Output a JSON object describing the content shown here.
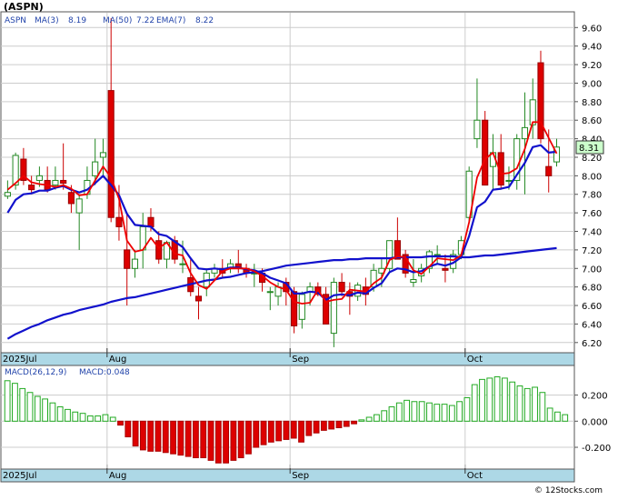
{
  "ticker_label": "(ASPN)",
  "legend": {
    "symbol": "ASPN",
    "ma3_label": "MA(3)",
    "ma3_value": "8.19",
    "ma50_label": "MA(50)",
    "ma50_value": "7.22",
    "ema7_label": "EMA(7)",
    "ema7_value": "8.22"
  },
  "last_price_badge": "8.31",
  "macd_legend": {
    "params": "MACD(26,12,9)",
    "value_text": "MACD:0.048"
  },
  "watermark": "© 12Stocks.com",
  "colors": {
    "up_candle": "#33aa33",
    "down_candle": "#dd0000",
    "ma3": "#ee0000",
    "ma50": "#1111cc",
    "ema7": "#1111cc",
    "macd_up": "#22aa22",
    "macd_down": "#dd0000",
    "axis_band": "#add8e6",
    "badge_bg": "#ccffcc"
  },
  "chart_data": [
    {
      "type": "candlestick",
      "title": "ASPN",
      "yticks": [
        "9.60",
        "9.40",
        "9.20",
        "9.00",
        "8.80",
        "8.60",
        "8.40",
        "8.20",
        "8.00",
        "7.80",
        "7.60",
        "7.40",
        "7.20",
        "7.00",
        "6.80",
        "6.60",
        "6.40",
        "6.20"
      ],
      "x_labels": [
        "2025Jul",
        "Aug",
        "Sep",
        "Oct"
      ],
      "grid": true,
      "candles": [
        [
          7.78,
          7.95,
          7.75,
          7.82
        ],
        [
          7.9,
          8.25,
          7.85,
          8.22
        ],
        [
          8.18,
          8.3,
          7.9,
          7.95
        ],
        [
          7.9,
          8.0,
          7.8,
          7.85
        ],
        [
          7.95,
          8.1,
          7.88,
          8.0
        ],
        [
          7.95,
          8.1,
          7.82,
          7.85
        ],
        [
          7.9,
          8.1,
          7.85,
          7.95
        ],
        [
          7.95,
          8.35,
          7.85,
          7.92
        ],
        [
          7.82,
          7.9,
          7.6,
          7.7
        ],
        [
          7.6,
          7.8,
          7.2,
          7.75
        ],
        [
          7.8,
          8.1,
          7.75,
          7.95
        ],
        [
          8.0,
          8.4,
          7.9,
          8.15
        ],
        [
          8.2,
          8.4,
          8.0,
          8.25
        ],
        [
          8.92,
          9.7,
          7.5,
          7.55
        ],
        [
          7.55,
          7.9,
          7.3,
          7.45
        ],
        [
          7.2,
          7.6,
          6.6,
          7.0
        ],
        [
          7.0,
          7.2,
          6.9,
          7.1
        ],
        [
          7.2,
          7.6,
          7.0,
          7.45
        ],
        [
          7.55,
          7.65,
          7.4,
          7.45
        ],
        [
          7.3,
          7.4,
          7.05,
          7.1
        ],
        [
          7.1,
          7.3,
          7.0,
          7.28
        ],
        [
          7.3,
          7.35,
          7.05,
          7.1
        ],
        [
          7.05,
          7.3,
          6.95,
          7.05
        ],
        [
          6.9,
          7.1,
          6.7,
          6.75
        ],
        [
          6.7,
          6.8,
          6.45,
          6.65
        ],
        [
          6.8,
          7.0,
          6.7,
          6.95
        ],
        [
          6.95,
          7.05,
          6.9,
          7.0
        ],
        [
          7.0,
          7.1,
          6.9,
          6.95
        ],
        [
          7.0,
          7.1,
          6.95,
          7.05
        ],
        [
          7.05,
          7.2,
          6.95,
          7.0
        ],
        [
          7.0,
          7.05,
          6.9,
          6.95
        ],
        [
          6.95,
          7.05,
          6.8,
          6.95
        ],
        [
          6.95,
          7.0,
          6.75,
          6.85
        ],
        [
          6.75,
          6.8,
          6.55,
          6.75
        ],
        [
          6.7,
          6.85,
          6.6,
          6.8
        ],
        [
          6.85,
          6.9,
          6.6,
          6.75
        ],
        [
          6.75,
          6.8,
          6.3,
          6.38
        ],
        [
          6.45,
          6.75,
          6.35,
          6.72
        ],
        [
          6.75,
          6.85,
          6.6,
          6.8
        ],
        [
          6.8,
          6.85,
          6.7,
          6.72
        ],
        [
          6.72,
          6.8,
          6.4,
          6.4
        ],
        [
          6.3,
          6.9,
          6.15,
          6.85
        ],
        [
          6.85,
          6.95,
          6.7,
          6.75
        ],
        [
          6.75,
          6.85,
          6.5,
          6.7
        ],
        [
          6.7,
          6.85,
          6.65,
          6.82
        ],
        [
          6.8,
          6.9,
          6.6,
          6.72
        ],
        [
          6.8,
          7.05,
          6.75,
          6.98
        ],
        [
          6.95,
          7.1,
          6.8,
          7.0
        ],
        [
          7.0,
          7.3,
          6.95,
          7.3
        ],
        [
          7.3,
          7.55,
          7.1,
          7.1
        ],
        [
          7.15,
          7.2,
          6.9,
          6.95
        ],
        [
          6.85,
          7.1,
          6.8,
          6.88
        ],
        [
          6.92,
          7.05,
          6.85,
          7.0
        ],
        [
          7.0,
          7.2,
          6.95,
          7.18
        ],
        [
          7.15,
          7.25,
          7.05,
          7.15
        ],
        [
          7.0,
          7.15,
          6.85,
          6.98
        ],
        [
          7.0,
          7.2,
          6.95,
          7.15
        ],
        [
          7.15,
          7.35,
          7.1,
          7.3
        ],
        [
          7.55,
          8.1,
          7.5,
          8.05
        ],
        [
          8.4,
          9.05,
          8.3,
          8.6
        ],
        [
          8.6,
          8.7,
          7.9,
          7.9
        ],
        [
          8.1,
          8.45,
          7.85,
          8.25
        ],
        [
          8.25,
          8.45,
          7.85,
          7.9
        ],
        [
          7.95,
          8.1,
          7.85,
          7.95
        ],
        [
          7.95,
          8.45,
          7.85,
          8.4
        ],
        [
          8.4,
          8.9,
          7.8,
          8.52
        ],
        [
          8.55,
          9.05,
          8.4,
          8.82
        ],
        [
          9.22,
          9.35,
          8.35,
          8.4
        ],
        [
          8.1,
          8.5,
          7.82,
          8.0
        ],
        [
          8.15,
          8.4,
          8.1,
          8.31
        ]
      ],
      "ma3": [
        7.85,
        7.92,
        8.0,
        7.93,
        7.91,
        7.9,
        7.88,
        7.9,
        7.86,
        7.79,
        7.8,
        7.95,
        8.1,
        7.98,
        7.75,
        7.3,
        7.18,
        7.2,
        7.33,
        7.22,
        7.28,
        7.16,
        7.14,
        6.95,
        6.82,
        6.78,
        6.87,
        6.97,
        7.0,
        7.0,
        7.0,
        6.97,
        6.92,
        6.85,
        6.8,
        6.77,
        6.64,
        6.62,
        6.63,
        6.77,
        6.64,
        6.66,
        6.67,
        6.77,
        6.76,
        6.75,
        6.84,
        6.9,
        7.09,
        7.13,
        7.12,
        6.98,
        6.94,
        7.02,
        7.11,
        7.1,
        7.09,
        7.14,
        7.5,
        7.98,
        8.18,
        8.25,
        8.02,
        8.03,
        8.08,
        8.29,
        8.58,
        8.58,
        8.41,
        8.24
      ],
      "ema7": [
        7.6,
        7.74,
        7.8,
        7.81,
        7.84,
        7.84,
        7.87,
        7.89,
        7.85,
        7.82,
        7.85,
        7.92,
        8.0,
        7.9,
        7.79,
        7.59,
        7.47,
        7.46,
        7.45,
        7.37,
        7.35,
        7.29,
        7.23,
        7.11,
        7.0,
        6.99,
        7.0,
        6.99,
        7.01,
        7.01,
        6.99,
        6.98,
        6.95,
        6.9,
        6.87,
        6.84,
        6.73,
        6.73,
        6.75,
        6.74,
        6.66,
        6.71,
        6.72,
        6.71,
        6.74,
        6.73,
        6.79,
        6.84,
        6.96,
        7.0,
        6.99,
        6.96,
        6.97,
        7.02,
        7.05,
        7.03,
        7.06,
        7.12,
        7.35,
        7.66,
        7.72,
        7.85,
        7.86,
        7.88,
        8.01,
        8.14,
        8.31,
        8.33,
        8.25,
        8.26
      ],
      "ma50": [
        6.24,
        6.29,
        6.33,
        6.37,
        6.4,
        6.44,
        6.47,
        6.5,
        6.52,
        6.55,
        6.57,
        6.59,
        6.61,
        6.64,
        6.66,
        6.68,
        6.69,
        6.71,
        6.73,
        6.75,
        6.77,
        6.79,
        6.81,
        6.83,
        6.85,
        6.87,
        6.88,
        6.9,
        6.91,
        6.93,
        6.95,
        6.96,
        6.97,
        6.99,
        7.01,
        7.03,
        7.04,
        7.05,
        7.06,
        7.07,
        7.08,
        7.09,
        7.09,
        7.1,
        7.1,
        7.11,
        7.11,
        7.11,
        7.11,
        7.12,
        7.12,
        7.12,
        7.12,
        7.13,
        7.13,
        7.13,
        7.13,
        7.12,
        7.12,
        7.13,
        7.14,
        7.14,
        7.15,
        7.16,
        7.17,
        7.18,
        7.19,
        7.2,
        7.21,
        7.22
      ]
    },
    {
      "type": "bar",
      "title": "MACD(26,12,9)",
      "yticks": [
        "0.200",
        "0.000",
        "-0.200"
      ],
      "x_labels": [
        "2025Jul",
        "Aug",
        "Sep",
        "Oct"
      ],
      "values": [
        0.31,
        0.29,
        0.25,
        0.22,
        0.19,
        0.17,
        0.14,
        0.11,
        0.09,
        0.07,
        0.06,
        0.04,
        0.04,
        0.05,
        0.03,
        -0.03,
        -0.12,
        -0.19,
        -0.22,
        -0.23,
        -0.23,
        -0.24,
        -0.25,
        -0.26,
        -0.27,
        -0.28,
        -0.28,
        -0.3,
        -0.32,
        -0.32,
        -0.3,
        -0.28,
        -0.25,
        -0.2,
        -0.18,
        -0.16,
        -0.15,
        -0.14,
        -0.13,
        -0.16,
        -0.11,
        -0.09,
        -0.07,
        -0.06,
        -0.05,
        -0.04,
        -0.02,
        0.01,
        0.03,
        0.05,
        0.08,
        0.11,
        0.14,
        0.16,
        0.15,
        0.15,
        0.14,
        0.13,
        0.13,
        0.12,
        0.15,
        0.18,
        0.28,
        0.32,
        0.33,
        0.34,
        0.33,
        0.3,
        0.27,
        0.25,
        0.26,
        0.22,
        0.1,
        0.07,
        0.05
      ]
    }
  ]
}
